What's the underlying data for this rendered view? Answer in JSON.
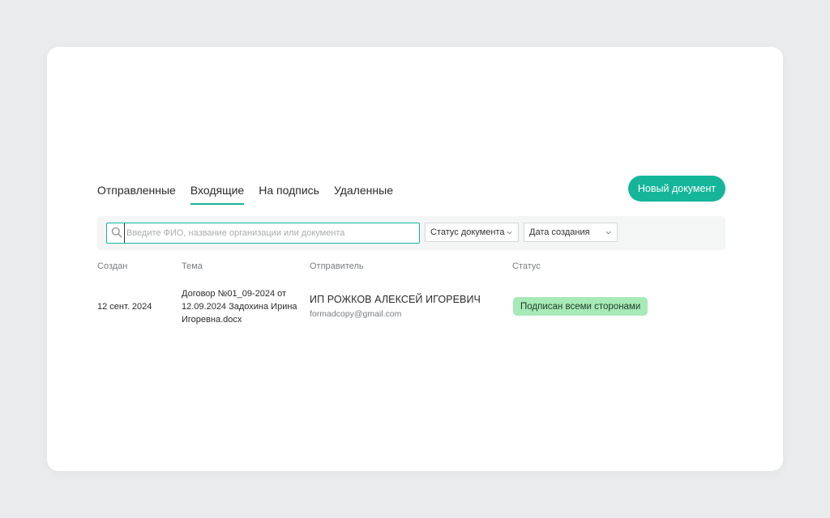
{
  "tabs": [
    {
      "label": "Отправленные",
      "active": false
    },
    {
      "label": "Входящие",
      "active": true
    },
    {
      "label": "На подпись",
      "active": false
    },
    {
      "label": "Удаленные",
      "active": false
    }
  ],
  "new_document_button": "Новый документ",
  "search": {
    "placeholder": "Введите ФИО, название организации или документа",
    "value": ""
  },
  "filters": {
    "status": "Статус документа",
    "date": "Дата создания"
  },
  "table": {
    "columns": [
      "Создан",
      "Тема",
      "Отправитель",
      "Статус"
    ],
    "rows": [
      {
        "created": "12 сент. 2024",
        "subject_lines": [
          "Договор №01_09-2024 от",
          "12.09.2024 Задохина Ирина",
          "Игоревна.docx"
        ],
        "sender_name": "ИП РОЖКОВ АЛЕКСЕЙ ИГОРЕВИЧ",
        "sender_email": "formadcopy@gmail.com",
        "status": "Подписан всеми сторонами"
      }
    ]
  },
  "colors": {
    "accent": "#15b59a",
    "status_badge_bg": "#a6eab8",
    "background": "#e9ebec"
  },
  "icons": [
    "search-icon",
    "chevron-down-icon"
  ]
}
